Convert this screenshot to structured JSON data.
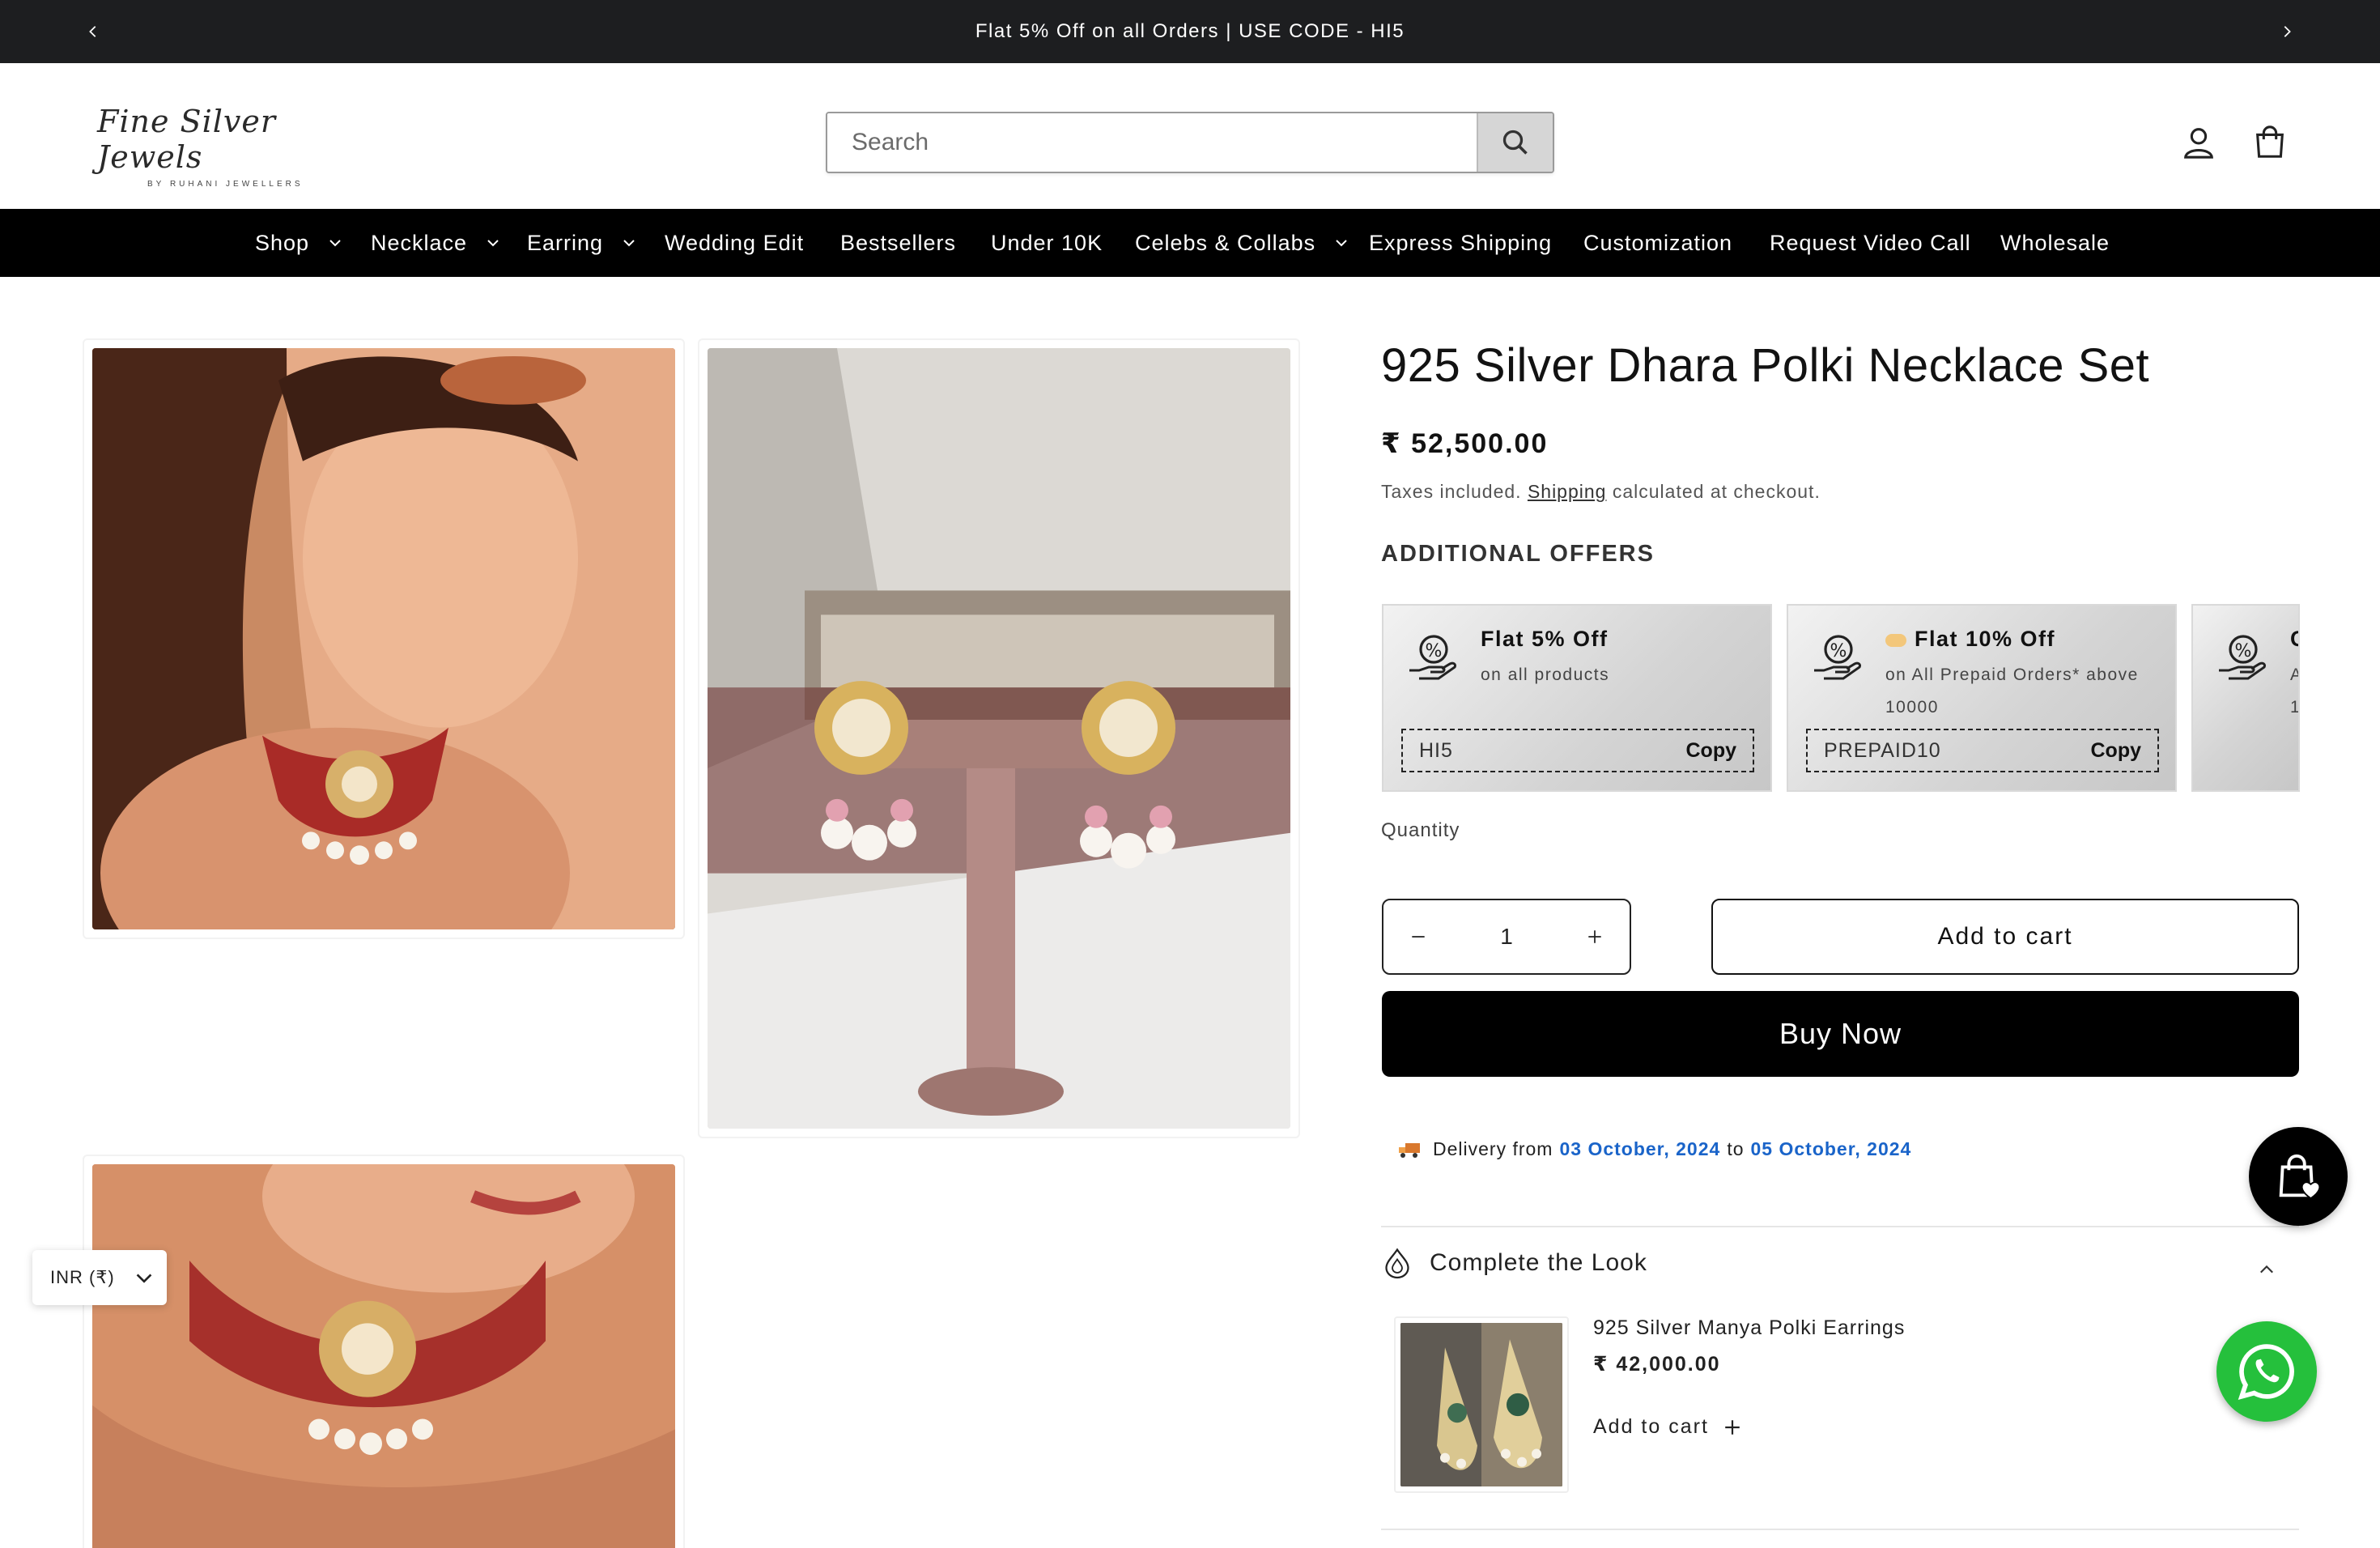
{
  "announcement": {
    "text": "Flat 5% Off on all Orders | USE CODE - HI5"
  },
  "header": {
    "logo_script": "Fine Silver Jewels",
    "logo_byline": "BY RUHANI JEWELLERS",
    "search_placeholder": "Search"
  },
  "nav": [
    {
      "label": "Shop",
      "dropdown": true
    },
    {
      "label": "Necklace",
      "dropdown": true
    },
    {
      "label": "Earring",
      "dropdown": true
    },
    {
      "label": "Wedding Edit",
      "dropdown": false
    },
    {
      "label": "Bestsellers",
      "dropdown": false
    },
    {
      "label": "Under 10K",
      "dropdown": false
    },
    {
      "label": "Celebs & Collabs",
      "dropdown": true
    },
    {
      "label": "Express Shipping",
      "dropdown": false
    },
    {
      "label": "Customization",
      "dropdown": false
    },
    {
      "label": "Request Video Call",
      "dropdown": false
    },
    {
      "label": "Wholesale",
      "dropdown": false
    }
  ],
  "product": {
    "title": "925 Silver Dhara Polki Necklace Set",
    "price": "₹ 52,500.00",
    "taxes_prefix": "Taxes included.",
    "taxes_link": "Shipping",
    "taxes_suffix": "calculated at checkout.",
    "offers_heading": "ADDITIONAL OFFERS",
    "offers": [
      {
        "title": "Flat 5% Off",
        "desc": "on all products",
        "code": "HI5",
        "copy": "Copy"
      },
      {
        "title": "Flat 10% Off",
        "desc": "on All Prepaid Orders* above 10000",
        "code": "PREPAID10",
        "copy": "Copy"
      },
      {
        "title": "C",
        "desc": "A",
        "desc2": "1",
        "code": "",
        "copy": ""
      }
    ],
    "quantity_label": "Quantity",
    "quantity_value": "1",
    "add_to_cart": "Add to cart",
    "buy_now": "Buy Now",
    "delivery": {
      "prefix": "Delivery from",
      "from": "03 October, 2024",
      "mid": "to",
      "to": "05 October, 2024"
    }
  },
  "complete_look": {
    "heading": "Complete the Look",
    "item_name": "925 Silver Manya Polki Earrings",
    "item_price": "₹ 42,000.00",
    "item_add": "Add to cart"
  },
  "currency": {
    "label": "INR (₹)"
  },
  "colors": {
    "nav_bg": "#000000",
    "announce_bg": "#1d1e20",
    "date_blue": "#1a64c9",
    "whatsapp": "#25c03c"
  }
}
